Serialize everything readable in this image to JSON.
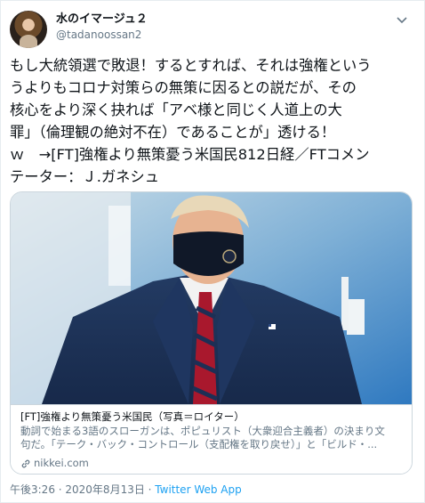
{
  "tweet": {
    "author_name": "水のイマージュ２",
    "author_handle": "@tadanoossan2",
    "text": "もし大統領選で敗退！するとすれば、それは強権という\nうよりもコロナ対策らの無策に因るとの説だが、その\n核心をより深く抉れば「アベ様と同じく人道上の大\n罪」（倫理観の絶対不在）であることが」透ける！\nｗ　→[FT]強権より無策憂う米国民812日経／FTコメン\nテーター：Ｊ.ガネシュ"
  },
  "card": {
    "title": "[FT]強権より無策憂う米国民（写真＝ロイター）",
    "description": "動詞で始まる3語のスローガンは、ポピュリスト（大衆迎合主義者）の決まり文\n句だ。「テーク・バック・コントロール（支配権を取り戻せ）」と「ビルド・...",
    "domain": "nikkei.com"
  },
  "footer": {
    "timestamp": "午後3:26 · 2020年8月13日 · ",
    "app": "Twitter Web App"
  },
  "icons": {
    "chevron": "chevron-down-icon",
    "link": "link-icon"
  },
  "colors": {
    "accent": "#1da1f2",
    "secondary_text": "#657786"
  }
}
